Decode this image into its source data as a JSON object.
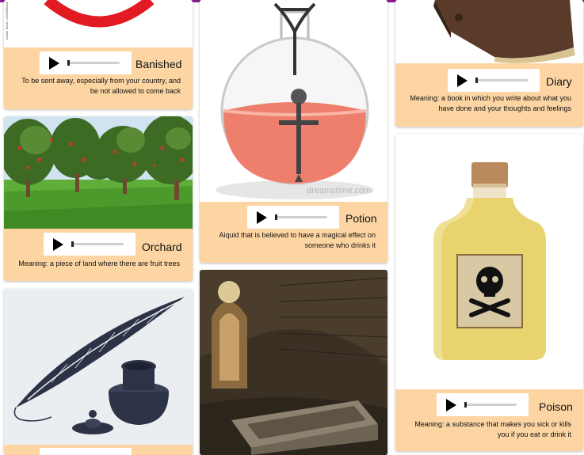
{
  "cards": {
    "banished": {
      "word": "Banished",
      "definition": "To be sent away, especially from your country, and be not allowed to come back",
      "watermark": "Adobe Stock | #200580449"
    },
    "orchard": {
      "word": "Orchard",
      "definition": "Meaning: a piece of land where there are fruit trees"
    },
    "potion": {
      "word": "Potion",
      "definition": "Aiquid that is believed to have a magical effect on someone who drinks it",
      "watermark": "dreamstime.com"
    },
    "diary": {
      "word": "Diary",
      "definition": "Meaning: a book in which you write about what you have done and your thoughts and feelings"
    },
    "poison": {
      "word": "Poison",
      "definition": "Meaning: a substance that makes you sick or kills you if you eat or drink it"
    }
  },
  "colors": {
    "card_bg": "#fcd5a3",
    "top_bar": "#8a1a8c"
  },
  "icons": [
    "play-icon"
  ]
}
